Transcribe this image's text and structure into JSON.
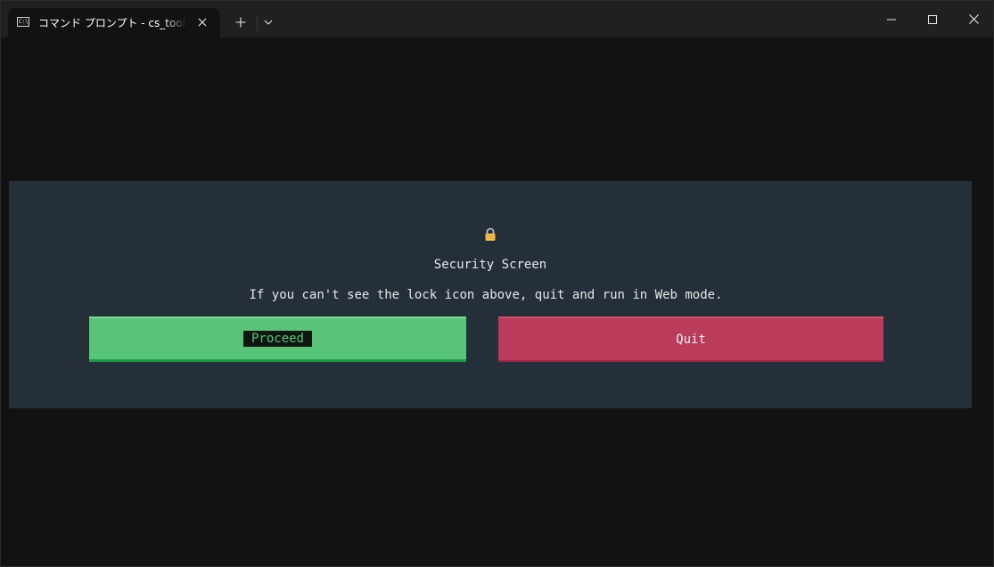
{
  "titlebar": {
    "tab_title": "コマンド プロンプト - cs_tools  tools",
    "tab_icon_text": "C:\\",
    "tab_icon_name": "command-prompt-icon",
    "new_tab_icon": "plus-icon",
    "dropdown_icon": "chevron-down-icon",
    "window_controls": [
      "minimize-icon",
      "maximize-icon",
      "close-icon"
    ]
  },
  "security": {
    "lock_icon": "lock-icon",
    "heading": "Security Screen",
    "message": "If you can't see the lock icon above, quit and run in Web mode.",
    "proceed_label": "Proceed",
    "quit_label": "Quit"
  },
  "colors": {
    "terminal_background": "#121212",
    "panel_background": "#252f39",
    "proceed": "#57c477",
    "quit": "#ba3c5a",
    "lock": "#f2c14e"
  }
}
